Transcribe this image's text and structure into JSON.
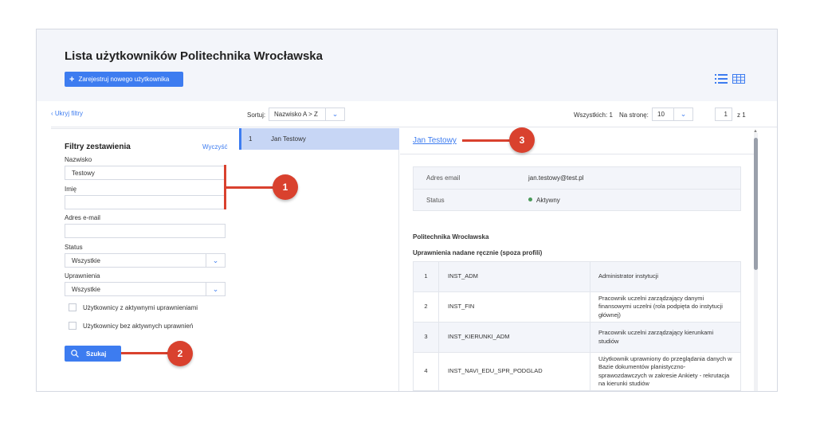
{
  "page": {
    "title": "Lista użytkowników Politechnika Wrocławska",
    "register_button": "Zarejestruj nowego użytkownika"
  },
  "toolbar": {
    "hide_filters": "Ukryj filtry",
    "sort_label": "Sortuj:",
    "sort_value": "Nazwisko A > Z",
    "total": "Wszystkich: 1",
    "per_page_label": "Na stronę:",
    "per_page_value": "10",
    "page_current": "1",
    "page_of": "z  1"
  },
  "filters": {
    "title": "Filtry zestawienia",
    "clear": "Wyczyść",
    "surname_label": "Nazwisko",
    "surname_value": "Testowy",
    "firstname_label": "Imię",
    "firstname_value": "",
    "email_label": "Adres e-mail",
    "email_value": "",
    "status_label": "Status",
    "status_value": "Wszystkie",
    "permissions_label": "Uprawnienia",
    "permissions_value": "Wszystkie",
    "check_active": "Użytkownicy z aktywnymi uprawnieniami",
    "check_inactive": "Użytkownicy bez aktywnych uprawnień",
    "search_button": "Szukaj"
  },
  "list": {
    "items": [
      {
        "num": "1",
        "name": "Jan Testowy"
      }
    ]
  },
  "detail": {
    "name": "Jan Testowy",
    "email_label": "Adres email",
    "email_value": "jan.testowy@test.pl",
    "status_label": "Status",
    "status_value": "Aktywny",
    "institution": "Politechnika Wrocławska",
    "permissions_title": "Uprawnienia nadane ręcznie (spoza profili)",
    "permissions": [
      {
        "num": "1",
        "code": "INST_ADM",
        "desc": "Administrator instytucji"
      },
      {
        "num": "2",
        "code": "INST_FIN",
        "desc": "Pracownik uczelni zarządzający danymi finansowymi uczelni (rola podpięta do instytucji głównej)"
      },
      {
        "num": "3",
        "code": "INST_KIERUNKI_ADM",
        "desc": "Pracownik uczelni zarządzający kierunkami studiów"
      },
      {
        "num": "4",
        "code": "INST_NAVI_EDU_SPR_PODGLAD",
        "desc": "Użytkownik uprawniony do przeglądania danych w Bazie dokumentów planistyczno-sprawozdawczych w zakresie Ankiety - rekrutacja na kierunki studiów"
      }
    ]
  },
  "annotations": {
    "a1": "1",
    "a2": "2",
    "a3": "3"
  },
  "colors": {
    "accent": "#3d7cf0",
    "annotation": "#d9412e",
    "active_status": "#4a9a5a"
  }
}
